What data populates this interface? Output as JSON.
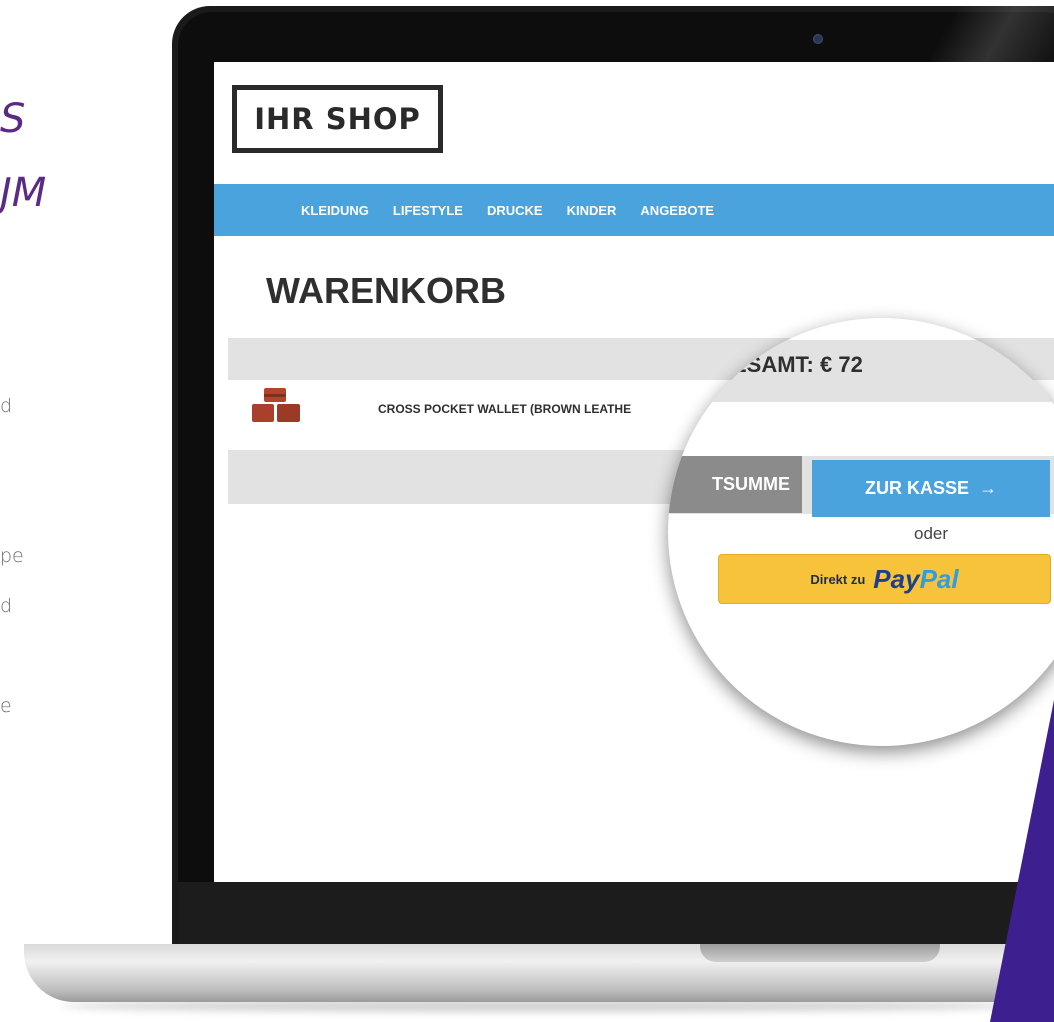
{
  "left_fragments": {
    "title_line1": "S",
    "title_line2": "JM",
    "line1": "d",
    "line2": "pe",
    "line3": "d",
    "line4": "e"
  },
  "shop": {
    "logo": "IHR SHOP",
    "nav": [
      "KLEIDUNG",
      "LIFESTYLE",
      "DRUCKE",
      "KINDER",
      "ANGEBOTE"
    ],
    "page_title": "WARENKORB",
    "product_name": "CROSS POCKET WALLET (BROWN LEATHE",
    "total_label": "ESAMT: €  72",
    "subtotal_button": "TSUMME",
    "checkout_button": "ZUR KASSE",
    "checkout_arrow": "→",
    "or_text": "oder",
    "paypal_prefix": "Direkt zu",
    "paypal_word_a": "Pay",
    "paypal_word_b": "Pal"
  },
  "colors": {
    "nav_blue": "#4aa3dc",
    "accent_purple": "#3d1f8f",
    "paypal_yellow": "#f7c33a",
    "subtotal_gray": "#8b8b8b"
  }
}
